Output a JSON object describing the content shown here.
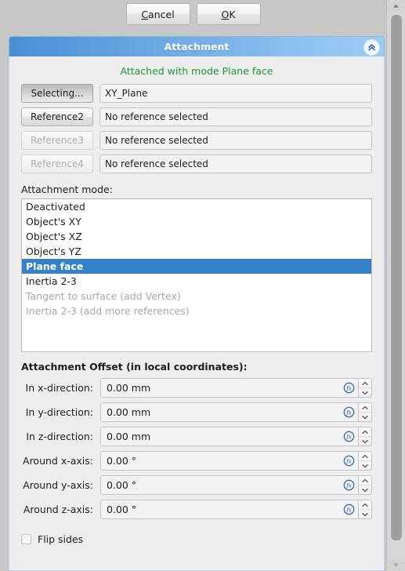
{
  "dialog": {
    "buttons": [
      {
        "name": "cancel-button",
        "label": "Cancel",
        "mnemonic": "C",
        "before": "",
        "after": "ancel"
      },
      {
        "name": "ok-button",
        "label": "OK",
        "mnemonic": "O",
        "before": "",
        "after": "K"
      }
    ]
  },
  "panel": {
    "title": "Attachment",
    "collapse_icon": "double-chevron-up-icon",
    "status_text": "Attached with mode Plane face",
    "status_color": "#1a9a36",
    "accent_color": "#3481c8"
  },
  "references": [
    {
      "button_label": "Selecting...",
      "value": "XY_Plane",
      "state": "pressed"
    },
    {
      "button_label": "Reference2",
      "value": "No reference selected",
      "state": "enabled"
    },
    {
      "button_label": "Reference3",
      "value": "No reference selected",
      "state": "disabled"
    },
    {
      "button_label": "Reference4",
      "value": "No reference selected",
      "state": "disabled"
    }
  ],
  "attachment_mode": {
    "label": "Attachment mode:",
    "items": [
      {
        "label": "Deactivated",
        "state": "normal"
      },
      {
        "label": "Object's XY",
        "state": "normal"
      },
      {
        "label": "Object's XZ",
        "state": "normal"
      },
      {
        "label": "Object's YZ",
        "state": "normal"
      },
      {
        "label": "Plane face",
        "state": "selected"
      },
      {
        "label": "Inertia 2-3",
        "state": "normal"
      },
      {
        "label": "Tangent to surface (add Vertex)",
        "state": "disabled"
      },
      {
        "label": "Inertia 2-3 (add more references)",
        "state": "disabled"
      }
    ]
  },
  "attachment_offset": {
    "title": "Attachment Offset (in local coordinates):",
    "rows": [
      {
        "label": "In x-direction:",
        "value": "0.00 mm"
      },
      {
        "label": "In y-direction:",
        "value": "0.00 mm"
      },
      {
        "label": "In z-direction:",
        "value": "0.00 mm"
      },
      {
        "label": "Around x-axis:",
        "value": "0.00 °"
      },
      {
        "label": "Around y-axis:",
        "value": "0.00 °"
      },
      {
        "label": "Around z-axis:",
        "value": "0.00 °"
      }
    ],
    "expression_icon": "fx-expression-icon",
    "spin_up_icon": "chevron-up-icon",
    "spin_down_icon": "chevron-down-icon"
  },
  "flip_sides": {
    "label": "Flip sides",
    "checked": false
  }
}
